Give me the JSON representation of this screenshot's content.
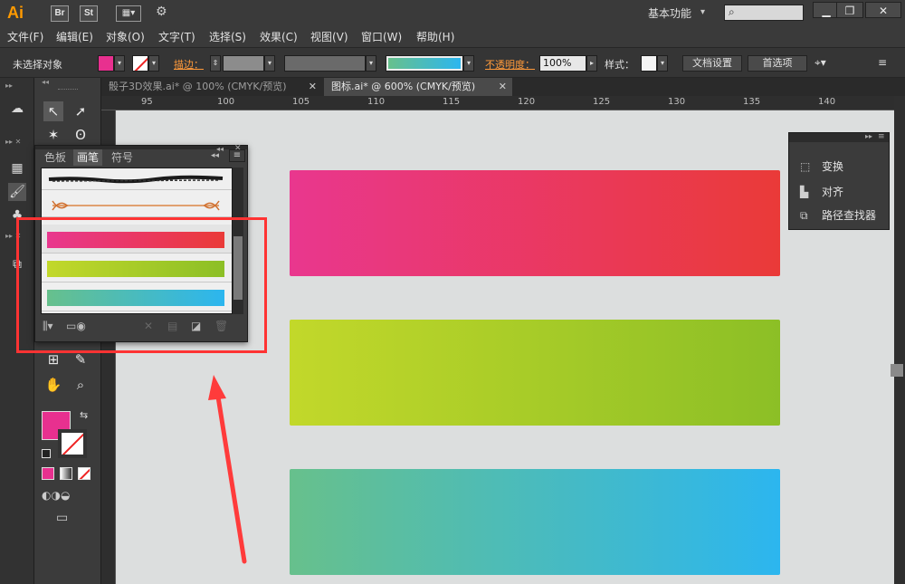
{
  "app": {
    "logo": "Ai",
    "workspace": "基本功能",
    "bridge_label": "Br",
    "stock_label": "St"
  },
  "menu": [
    "文件(F)",
    "编辑(E)",
    "对象(O)",
    "文字(T)",
    "选择(S)",
    "效果(C)",
    "视图(V)",
    "窗口(W)",
    "帮助(H)"
  ],
  "control": {
    "selection_status": "未选择对象",
    "stroke_label": "描边：",
    "opacity_label": "不透明度：",
    "opacity_value": "100%",
    "style_label": "样式：",
    "doc_setup": "文档设置",
    "preferences": "首选项"
  },
  "colors": {
    "accent": "#ff9a00",
    "fill": "#e8308f",
    "highlight": "#ff3333",
    "pink_grad_start": "#e9378e",
    "pink_grad_end": "#ea3a38",
    "green_grad_start": "#c2d82a",
    "green_grad_end": "#8cbf26",
    "teal_grad_start": "#67c08c",
    "teal_grad_end": "#2cb6ef"
  },
  "tabs": [
    {
      "label": "骰子3D效果.ai* @ 100% (CMYK/预览)",
      "active": false
    },
    {
      "label": "图标.ai* @ 600% (CMYK/预览)",
      "active": true
    }
  ],
  "ruler": {
    "h_ticks": [
      "95",
      "100",
      "105",
      "110",
      "115",
      "120",
      "125",
      "130",
      "135",
      "140"
    ]
  },
  "brush_panel": {
    "tabs": [
      "色板",
      "画笔",
      "符号"
    ],
    "active_tab": "画笔",
    "brushes": [
      "charcoal-brush",
      "arrow-line-brush",
      "pink-red-gradient-brush",
      "lime-green-gradient-brush",
      "teal-blue-gradient-brush"
    ]
  },
  "right_panel": {
    "items": [
      "变换",
      "对齐",
      "路径查找器"
    ]
  },
  "icons": [
    "search-icon",
    "selection-tool-icon",
    "direct-selection-icon",
    "magic-wand-icon",
    "lasso-icon",
    "hand-tool-icon",
    "zoom-tool-icon",
    "swap-icon",
    "close-icon",
    "collapse-icon",
    "panel-menu-icon"
  ]
}
